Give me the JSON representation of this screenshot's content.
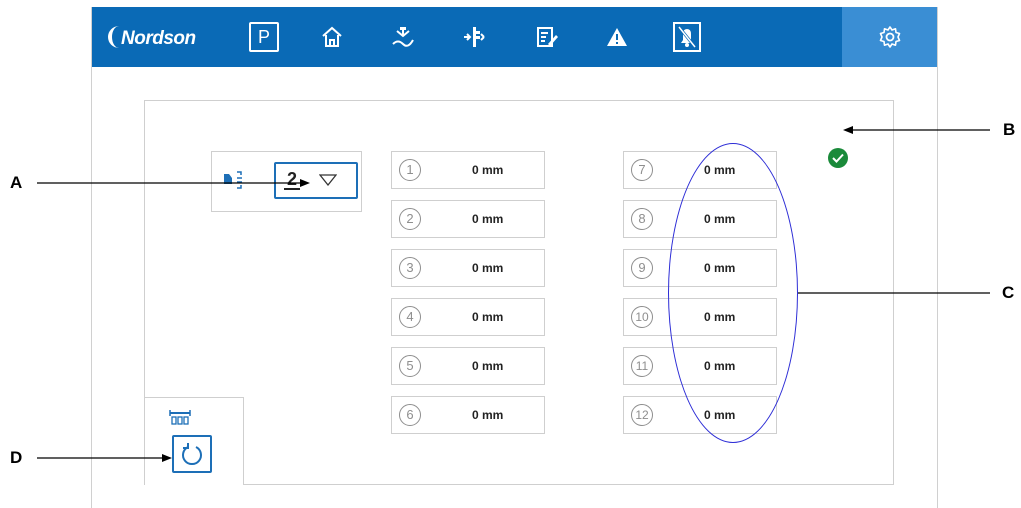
{
  "header": {
    "logo_text": "Nordson",
    "nav": [
      {
        "name": "production-mode",
        "glyph": "P"
      },
      {
        "name": "home"
      },
      {
        "name": "gun-setup"
      },
      {
        "name": "distance-settings"
      },
      {
        "name": "recipes"
      },
      {
        "name": "alarms"
      },
      {
        "name": "alarm-mute"
      },
      {
        "name": "settings",
        "active": true
      }
    ],
    "accent": "#0a6ab6",
    "active_color": "#3a8ed4"
  },
  "selector": {
    "value": "2",
    "icon": "gun-distance-icon"
  },
  "status": {
    "icon": "check-icon",
    "color": "#1a8a3a"
  },
  "fields_left": [
    {
      "num": "1",
      "value": "0 mm"
    },
    {
      "num": "2",
      "value": "0 mm"
    },
    {
      "num": "3",
      "value": "0 mm"
    },
    {
      "num": "4",
      "value": "0 mm"
    },
    {
      "num": "5",
      "value": "0 mm"
    },
    {
      "num": "6",
      "value": "0 mm"
    }
  ],
  "fields_right": [
    {
      "num": "7",
      "value": "0 mm"
    },
    {
      "num": "8",
      "value": "0 mm"
    },
    {
      "num": "9",
      "value": "0 mm"
    },
    {
      "num": "10",
      "value": "0 mm"
    },
    {
      "num": "11",
      "value": "0 mm"
    },
    {
      "num": "12",
      "value": "0 mm"
    }
  ],
  "reset": {
    "icon": "reset-icon",
    "panel_icon": "gun-bar-icon"
  },
  "callouts": {
    "a": "A",
    "b": "B",
    "c": "C",
    "d": "D"
  }
}
